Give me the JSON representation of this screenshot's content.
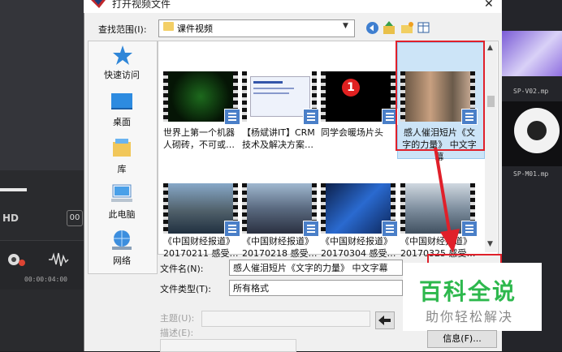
{
  "background": {
    "hd_label": "HD",
    "hd_button": "00",
    "timecode": "00:00:04:00",
    "right_labels": [
      "SP-V02.mp",
      "SP-M01.mp"
    ]
  },
  "dialog": {
    "title": "打开视频文件",
    "close": "✕",
    "look_in_label": "查找范围(I):",
    "look_in_value": "课件视频",
    "places": [
      "快速访问",
      "桌面",
      "库",
      "此电脑",
      "网络"
    ],
    "files": [
      {
        "name": "世界上第一个机器人砌砖，不可或…",
        "style": "green"
      },
      {
        "name": "【杨斌讲IT】CRM技术及解决方案…",
        "style": "slides"
      },
      {
        "name": "同学会暖场片头",
        "style": "countdown",
        "number": "1"
      },
      {
        "name": "感人催泪短片《文字的力量》 中文字幕",
        "style": "people"
      },
      {
        "name": "《中国财经报道》 20170211 感受…",
        "style": "city"
      },
      {
        "name": "《中国财经报道》 20170218 感受…",
        "style": "city2"
      },
      {
        "name": "《中国财经报道》 20170304 感受…",
        "style": "tech"
      },
      {
        "name": "《中国财经报道》 20170325 感受…",
        "style": "city3"
      }
    ],
    "filename_label": "文件名(N):",
    "filename_value": "感人催泪短片《文字的力量》 中文字幕",
    "filetype_label": "文件类型(T):",
    "filetype_value": "所有格式",
    "subject_label": "主题(U):",
    "desc_label": "描述(E):",
    "info_button": "信息(F)..."
  },
  "watermark": {
    "main": "百科全说",
    "sub": "助你轻松解决"
  },
  "colors": {
    "highlight_red": "#e0202a",
    "selection": "#cce4f7",
    "brand_green": "#2db84d"
  }
}
